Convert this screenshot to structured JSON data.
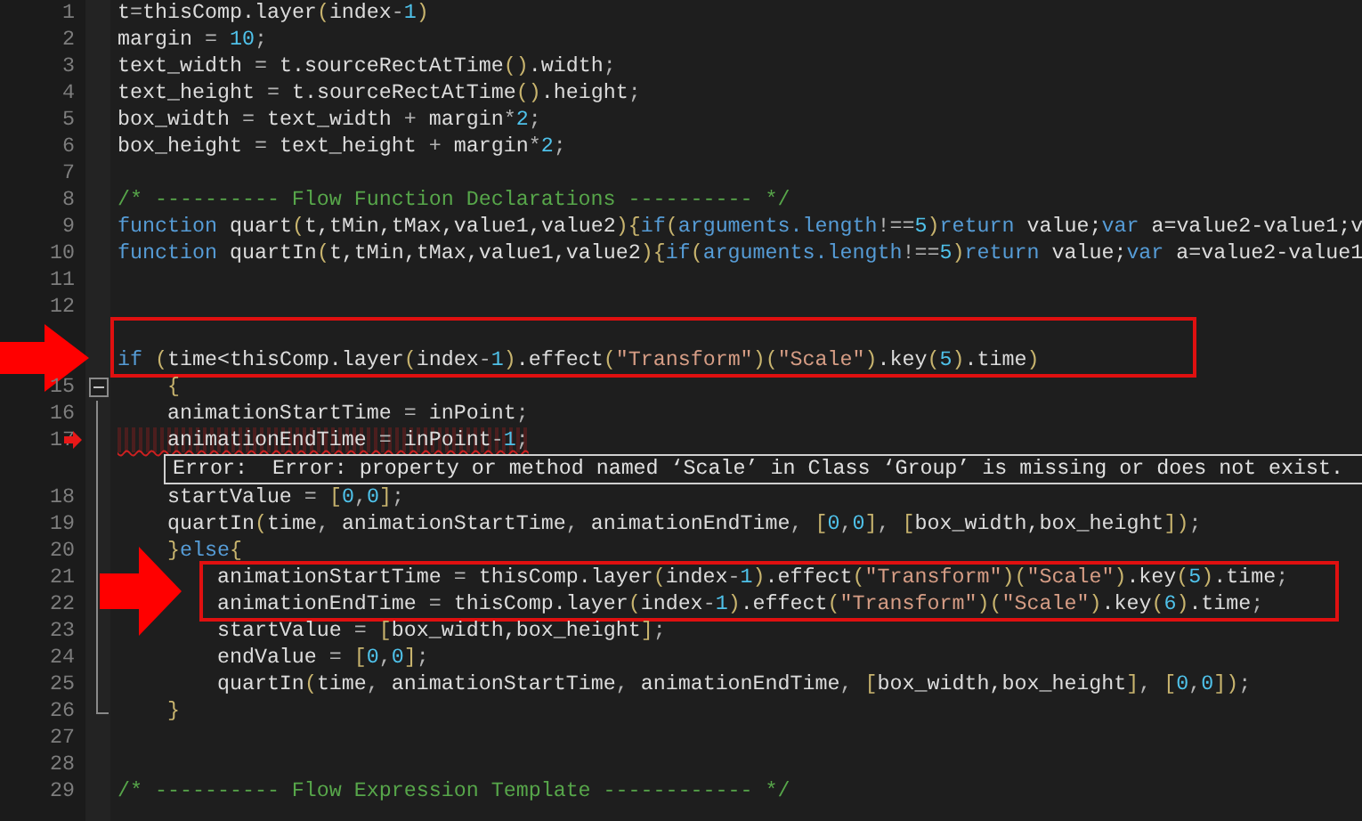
{
  "editor": {
    "rows": [
      {
        "kind": "code",
        "number": "1",
        "tokens": [
          {
            "kind": "id",
            "t": "t"
          },
          {
            "kind": "op",
            "t": "="
          },
          {
            "kind": "id",
            "t": "thisComp.layer"
          },
          {
            "kind": "br",
            "t": "("
          },
          {
            "kind": "id",
            "t": "index"
          },
          {
            "kind": "op",
            "t": "-"
          },
          {
            "kind": "num",
            "t": "1"
          },
          {
            "kind": "br",
            "t": ")"
          }
        ]
      },
      {
        "kind": "code",
        "number": "2",
        "tokens": [
          {
            "kind": "id",
            "t": "margin"
          },
          {
            "kind": "op",
            "t": " = "
          },
          {
            "kind": "num",
            "t": "10"
          },
          {
            "kind": "op",
            "t": ";"
          }
        ]
      },
      {
        "kind": "code",
        "number": "3",
        "tokens": [
          {
            "kind": "id",
            "t": "text_width"
          },
          {
            "kind": "op",
            "t": " = "
          },
          {
            "kind": "id",
            "t": "t.sourceRectAtTime"
          },
          {
            "kind": "br",
            "t": "()"
          },
          {
            "kind": "id",
            "t": ".width"
          },
          {
            "kind": "op",
            "t": ";"
          }
        ]
      },
      {
        "kind": "code",
        "number": "4",
        "tokens": [
          {
            "kind": "id",
            "t": "text_height"
          },
          {
            "kind": "op",
            "t": " = "
          },
          {
            "kind": "id",
            "t": "t.sourceRectAtTime"
          },
          {
            "kind": "br",
            "t": "()"
          },
          {
            "kind": "id",
            "t": ".height"
          },
          {
            "kind": "op",
            "t": ";"
          }
        ]
      },
      {
        "kind": "code",
        "number": "5",
        "tokens": [
          {
            "kind": "id",
            "t": "box_width"
          },
          {
            "kind": "op",
            "t": " = "
          },
          {
            "kind": "id",
            "t": "text_width"
          },
          {
            "kind": "op",
            "t": " + "
          },
          {
            "kind": "id",
            "t": "margin"
          },
          {
            "kind": "op",
            "t": "*"
          },
          {
            "kind": "num",
            "t": "2"
          },
          {
            "kind": "op",
            "t": ";"
          }
        ]
      },
      {
        "kind": "code",
        "number": "6",
        "tokens": [
          {
            "kind": "id",
            "t": "box_height"
          },
          {
            "kind": "op",
            "t": " = "
          },
          {
            "kind": "id",
            "t": "text_height"
          },
          {
            "kind": "op",
            "t": " + "
          },
          {
            "kind": "id",
            "t": "margin"
          },
          {
            "kind": "op",
            "t": "*"
          },
          {
            "kind": "num",
            "t": "2"
          },
          {
            "kind": "op",
            "t": ";"
          }
        ]
      },
      {
        "kind": "code",
        "number": "7"
      },
      {
        "kind": "code",
        "number": "8",
        "tokens": [
          {
            "kind": "com",
            "t": "/* ---------- Flow Function Declarations ---------- */"
          }
        ]
      },
      {
        "kind": "code",
        "number": "9",
        "tokens": [
          {
            "kind": "kw",
            "t": "function"
          },
          {
            "kind": "id",
            "t": " quart"
          },
          {
            "kind": "br",
            "t": "("
          },
          {
            "kind": "id",
            "t": "t,tMin,tMax,value1,value2"
          },
          {
            "kind": "br",
            "t": ")"
          },
          {
            "kind": "br",
            "t": "{"
          },
          {
            "kind": "kw",
            "t": "if"
          },
          {
            "kind": "br",
            "t": "("
          },
          {
            "kind": "kw",
            "t": "arguments.length"
          },
          {
            "kind": "op",
            "t": "!=="
          },
          {
            "kind": "num",
            "t": "5"
          },
          {
            "kind": "br",
            "t": ")"
          },
          {
            "kind": "kw",
            "t": "return"
          },
          {
            "kind": "id",
            "t": " value;"
          },
          {
            "kind": "kw",
            "t": "var"
          },
          {
            "kind": "id",
            "t": " a=value2-value1;v"
          }
        ]
      },
      {
        "kind": "code",
        "number": "10",
        "tokens": [
          {
            "kind": "kw",
            "t": "function"
          },
          {
            "kind": "id",
            "t": " quartIn"
          },
          {
            "kind": "br",
            "t": "("
          },
          {
            "kind": "id",
            "t": "t,tMin,tMax,value1,value2"
          },
          {
            "kind": "br",
            "t": ")"
          },
          {
            "kind": "br",
            "t": "{"
          },
          {
            "kind": "kw",
            "t": "if"
          },
          {
            "kind": "br",
            "t": "("
          },
          {
            "kind": "kw",
            "t": "arguments.length"
          },
          {
            "kind": "op",
            "t": "!=="
          },
          {
            "kind": "num",
            "t": "5"
          },
          {
            "kind": "br",
            "t": ")"
          },
          {
            "kind": "kw",
            "t": "return"
          },
          {
            "kind": "id",
            "t": " value;"
          },
          {
            "kind": "kw",
            "t": "var"
          },
          {
            "kind": "id",
            "t": " a=value2-value1"
          }
        ]
      },
      {
        "kind": "code",
        "number": "11"
      },
      {
        "kind": "code",
        "number": "12"
      },
      {
        "kind": "code",
        "boxed": true
      },
      {
        "kind": "code",
        "boxed": true,
        "gutter_arrow": true,
        "tokens": [
          {
            "kind": "kw",
            "t": "if "
          },
          {
            "kind": "br",
            "t": "("
          },
          {
            "kind": "id",
            "t": "time<thisComp.layer"
          },
          {
            "kind": "br",
            "t": "("
          },
          {
            "kind": "id",
            "t": "index"
          },
          {
            "kind": "op",
            "t": "-"
          },
          {
            "kind": "num",
            "t": "1"
          },
          {
            "kind": "br",
            "t": ")"
          },
          {
            "kind": "id",
            "t": ".effect"
          },
          {
            "kind": "br",
            "t": "("
          },
          {
            "kind": "str",
            "t": "\"Transform\""
          },
          {
            "kind": "br",
            "t": ")"
          },
          {
            "kind": "br",
            "t": "("
          },
          {
            "kind": "str",
            "t": "\"Scale\""
          },
          {
            "kind": "br",
            "t": ")"
          },
          {
            "kind": "id",
            "t": ".key"
          },
          {
            "kind": "br",
            "t": "("
          },
          {
            "kind": "num",
            "t": "5"
          },
          {
            "kind": "br",
            "t": ")"
          },
          {
            "kind": "id",
            "t": ".time"
          },
          {
            "kind": "br",
            "t": ")"
          }
        ]
      },
      {
        "kind": "code",
        "number": "15",
        "fold_start": true,
        "tokens": [
          {
            "kind": "br",
            "t": "    {"
          }
        ]
      },
      {
        "kind": "code",
        "number": "16",
        "tokens": [
          {
            "kind": "id",
            "t": "    animationStartTime"
          },
          {
            "kind": "op",
            "t": " = "
          },
          {
            "kind": "id",
            "t": "inPoint"
          },
          {
            "kind": "op",
            "t": ";"
          }
        ]
      },
      {
        "kind": "code",
        "number": "17",
        "error": true,
        "error_marker": true,
        "tokens": [
          {
            "kind": "id",
            "t": "    animationEndTime"
          },
          {
            "kind": "op",
            "t": " = "
          },
          {
            "kind": "id",
            "t": "inPoint"
          },
          {
            "kind": "op",
            "t": "-"
          },
          {
            "kind": "num",
            "t": "1"
          },
          {
            "kind": "op",
            "t": ";"
          }
        ]
      },
      {
        "kind": "tooltip",
        "text": "Error:  Error: property or method named ‘Scale’ in Class ‘Group’ is missing or does not exist."
      },
      {
        "kind": "code",
        "number": "18",
        "tokens": [
          {
            "kind": "id",
            "t": "    startValue"
          },
          {
            "kind": "op",
            "t": " = "
          },
          {
            "kind": "br",
            "t": "["
          },
          {
            "kind": "num",
            "t": "0"
          },
          {
            "kind": "op",
            "t": ","
          },
          {
            "kind": "num",
            "t": "0"
          },
          {
            "kind": "br",
            "t": "]"
          },
          {
            "kind": "op",
            "t": ";"
          }
        ]
      },
      {
        "kind": "code",
        "number": "19",
        "tokens": [
          {
            "kind": "id",
            "t": "    quartIn"
          },
          {
            "kind": "br",
            "t": "("
          },
          {
            "kind": "id",
            "t": "time"
          },
          {
            "kind": "op",
            "t": ", "
          },
          {
            "kind": "id",
            "t": "animationStartTime"
          },
          {
            "kind": "op",
            "t": ", "
          },
          {
            "kind": "id",
            "t": "animationEndTime"
          },
          {
            "kind": "op",
            "t": ", "
          },
          {
            "kind": "br",
            "t": "["
          },
          {
            "kind": "num",
            "t": "0"
          },
          {
            "kind": "op",
            "t": ","
          },
          {
            "kind": "num",
            "t": "0"
          },
          {
            "kind": "br",
            "t": "]"
          },
          {
            "kind": "op",
            "t": ", "
          },
          {
            "kind": "br",
            "t": "["
          },
          {
            "kind": "id",
            "t": "box_width,box_height"
          },
          {
            "kind": "br",
            "t": "]"
          },
          {
            "kind": "br",
            "t": ")"
          },
          {
            "kind": "op",
            "t": ";"
          }
        ]
      },
      {
        "kind": "code",
        "number": "20",
        "tokens": [
          {
            "kind": "br",
            "t": "    }"
          },
          {
            "kind": "kw",
            "t": "else"
          },
          {
            "kind": "br",
            "t": "{"
          }
        ]
      },
      {
        "kind": "code",
        "number": "21",
        "boxed": true,
        "inline_arrow": true,
        "tokens": [
          {
            "kind": "id",
            "t": "        animationStartTime"
          },
          {
            "kind": "op",
            "t": " = "
          },
          {
            "kind": "id",
            "t": "thisComp.layer"
          },
          {
            "kind": "br",
            "t": "("
          },
          {
            "kind": "id",
            "t": "index"
          },
          {
            "kind": "op",
            "t": "-"
          },
          {
            "kind": "num",
            "t": "1"
          },
          {
            "kind": "br",
            "t": ")"
          },
          {
            "kind": "id",
            "t": ".effect"
          },
          {
            "kind": "br",
            "t": "("
          },
          {
            "kind": "str",
            "t": "\"Transform\""
          },
          {
            "kind": "br",
            "t": ")"
          },
          {
            "kind": "br",
            "t": "("
          },
          {
            "kind": "str",
            "t": "\"Scale\""
          },
          {
            "kind": "br",
            "t": ")"
          },
          {
            "kind": "id",
            "t": ".key"
          },
          {
            "kind": "br",
            "t": "("
          },
          {
            "kind": "num",
            "t": "5"
          },
          {
            "kind": "br",
            "t": ")"
          },
          {
            "kind": "id",
            "t": ".time"
          },
          {
            "kind": "op",
            "t": ";"
          }
        ]
      },
      {
        "kind": "code",
        "number": "22",
        "boxed": true,
        "tokens": [
          {
            "kind": "id",
            "t": "        animationEndTime"
          },
          {
            "kind": "op",
            "t": " = "
          },
          {
            "kind": "id",
            "t": "thisComp.layer"
          },
          {
            "kind": "br",
            "t": "("
          },
          {
            "kind": "id",
            "t": "index"
          },
          {
            "kind": "op",
            "t": "-"
          },
          {
            "kind": "num",
            "t": "1"
          },
          {
            "kind": "br",
            "t": ")"
          },
          {
            "kind": "id",
            "t": ".effect"
          },
          {
            "kind": "br",
            "t": "("
          },
          {
            "kind": "str",
            "t": "\"Transform\""
          },
          {
            "kind": "br",
            "t": ")"
          },
          {
            "kind": "br",
            "t": "("
          },
          {
            "kind": "str",
            "t": "\"Scale\""
          },
          {
            "kind": "br",
            "t": ")"
          },
          {
            "kind": "id",
            "t": ".key"
          },
          {
            "kind": "br",
            "t": "("
          },
          {
            "kind": "num",
            "t": "6"
          },
          {
            "kind": "br",
            "t": ")"
          },
          {
            "kind": "id",
            "t": ".time"
          },
          {
            "kind": "op",
            "t": ";"
          }
        ]
      },
      {
        "kind": "code",
        "number": "23",
        "tokens": [
          {
            "kind": "id",
            "t": "        startValue"
          },
          {
            "kind": "op",
            "t": " = "
          },
          {
            "kind": "br",
            "t": "["
          },
          {
            "kind": "id",
            "t": "box_width,box_height"
          },
          {
            "kind": "br",
            "t": "]"
          },
          {
            "kind": "op",
            "t": ";"
          }
        ]
      },
      {
        "kind": "code",
        "number": "24",
        "tokens": [
          {
            "kind": "id",
            "t": "        endValue"
          },
          {
            "kind": "op",
            "t": " = "
          },
          {
            "kind": "br",
            "t": "["
          },
          {
            "kind": "num",
            "t": "0"
          },
          {
            "kind": "op",
            "t": ","
          },
          {
            "kind": "num",
            "t": "0"
          },
          {
            "kind": "br",
            "t": "]"
          },
          {
            "kind": "op",
            "t": ";"
          }
        ]
      },
      {
        "kind": "code",
        "number": "25",
        "tokens": [
          {
            "kind": "id",
            "t": "        quartIn"
          },
          {
            "kind": "br",
            "t": "("
          },
          {
            "kind": "id",
            "t": "time"
          },
          {
            "kind": "op",
            "t": ", "
          },
          {
            "kind": "id",
            "t": "animationStartTime"
          },
          {
            "kind": "op",
            "t": ", "
          },
          {
            "kind": "id",
            "t": "animationEndTime"
          },
          {
            "kind": "op",
            "t": ", "
          },
          {
            "kind": "br",
            "t": "["
          },
          {
            "kind": "id",
            "t": "box_width,box_height"
          },
          {
            "kind": "br",
            "t": "]"
          },
          {
            "kind": "op",
            "t": ", "
          },
          {
            "kind": "br",
            "t": "["
          },
          {
            "kind": "num",
            "t": "0"
          },
          {
            "kind": "op",
            "t": ","
          },
          {
            "kind": "num",
            "t": "0"
          },
          {
            "kind": "br",
            "t": "]"
          },
          {
            "kind": "br",
            "t": ")"
          },
          {
            "kind": "op",
            "t": ";"
          }
        ]
      },
      {
        "kind": "code",
        "number": "26",
        "fold_end": true,
        "tokens": [
          {
            "kind": "br",
            "t": "    }"
          }
        ]
      },
      {
        "kind": "code",
        "number": "27"
      },
      {
        "kind": "code",
        "number": "28"
      },
      {
        "kind": "code",
        "number": "29",
        "tokens": [
          {
            "kind": "com",
            "t": "/* ---------- Flow Expression Template ------------ */"
          }
        ]
      }
    ]
  }
}
